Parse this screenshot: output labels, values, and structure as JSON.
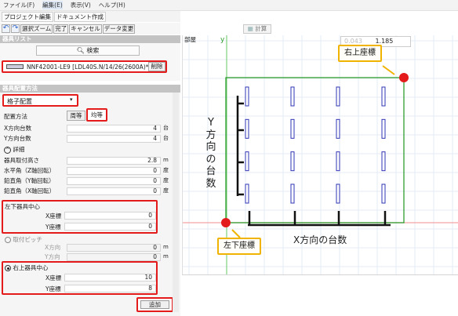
{
  "menu": [
    "ファイル(F)",
    "編集(E)",
    "表示(V)",
    "ヘルプ(H)"
  ],
  "subtabs": [
    "プロジェクト編集",
    "ドキュメント作成"
  ],
  "toolbar": {
    "undo_icon": "undo-icon",
    "redo_icon": "redo-icon",
    "select_zoom": "選択ズーム",
    "done": "完了",
    "cancel": "キャンセル",
    "data_change": "データ変更"
  },
  "canvas_toolbar": {
    "calc_label": "計算"
  },
  "equipment_list": {
    "section_title": "器具リスト",
    "search_label": "検索",
    "item_label": "NNF42001-LE9 [LDL40S.N/14/26(2600A)*2]",
    "delete_label": "削除"
  },
  "placement": {
    "section_title": "器具配置方法",
    "method_select": "格子配置",
    "method_label": "配置方法",
    "tab_equal": "周等",
    "tab_pitch": "均等",
    "x_count_label": "X方向台数",
    "x_count": "4",
    "y_count_label": "Y方向台数",
    "y_count": "4",
    "count_unit": "台",
    "detail_toggle": "詳細",
    "height_label": "器具取付高さ",
    "height": "2.8",
    "height_unit": "m",
    "horizontal_label": "水平角（Z軸回転）",
    "horizontal": "0",
    "vertical_y_label": "鉛直角（Y軸回転）",
    "vertical_y": "0",
    "vertical_x_label": "鉛直角（X軸回転）",
    "vertical_x": "0",
    "angle_unit": "度",
    "lower_left_title": "左下器具中心",
    "lower_left_x_label": "X座標",
    "lower_left_x": "0",
    "lower_left_y_label": "Y座標",
    "lower_left_y": "0",
    "pitch_option": "取付ピッチ",
    "pitch_x_label": "X方向",
    "pitch_x": "0",
    "pitch_y_label": "Y方向",
    "pitch_y": "0",
    "pitch_unit": "m",
    "upper_right_option": "右上器具中心",
    "upper_right_x_label": "X座標",
    "upper_right_x": "10",
    "upper_right_y_label": "Y座標",
    "upper_right_y": "8",
    "add_label": "追加"
  },
  "canvas": {
    "room_label": "部屋",
    "axis_y": "y",
    "coord_readout": "1.185",
    "coord_readout_left": "0.043",
    "callout_upper_right": "右上座標",
    "callout_lower_left": "左下座標",
    "y_count_annotation": "Y方向の台数",
    "x_count_annotation": "X方向の台数"
  },
  "colors": {
    "highlight_red": "#e31b1b",
    "callout_border": "#f0b400",
    "room_outline": "#2e9e2e",
    "grid_line": "#dde8f2",
    "luminaire": "#2f35b5",
    "axis_pink": "#f4a3a3",
    "axis_green": "#7fd27f"
  }
}
